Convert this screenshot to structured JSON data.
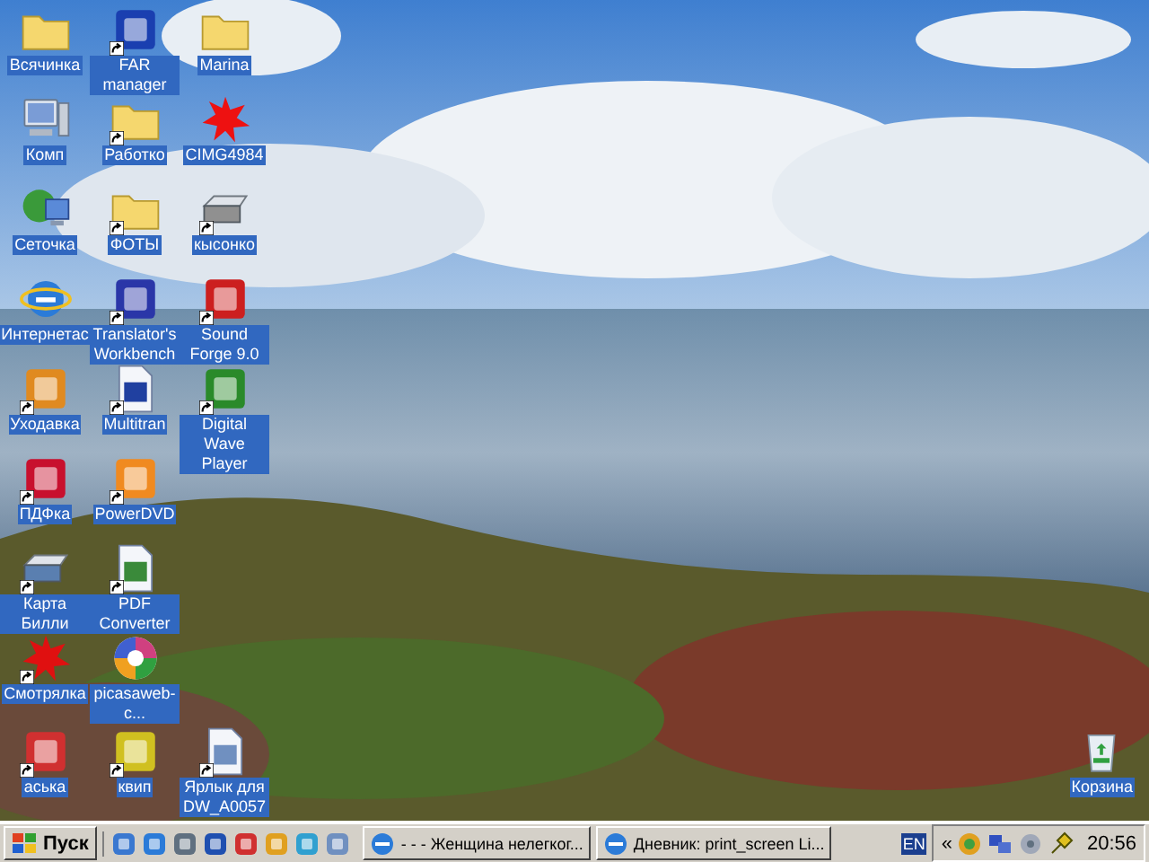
{
  "desktop": {
    "icon_columns": [
      [
        {
          "label": "Всячинка",
          "shortcut": false
        },
        {
          "label": "Комп",
          "shortcut": false
        },
        {
          "label": "Сеточка",
          "shortcut": false
        },
        {
          "label": "Интернетас",
          "shortcut": false
        },
        {
          "label": "Уходавка",
          "shortcut": true
        },
        {
          "label": "ПДФка",
          "shortcut": true
        },
        {
          "label": "Карта Билли",
          "shortcut": true
        },
        {
          "label": "Смотрялка",
          "shortcut": true
        },
        {
          "label": "аська",
          "shortcut": true
        }
      ],
      [
        {
          "label": "FAR manager",
          "shortcut": true
        },
        {
          "label": "Работко",
          "shortcut": true
        },
        {
          "label": "ФОТЫ",
          "shortcut": true
        },
        {
          "label": "Translator's Workbench",
          "shortcut": true
        },
        {
          "label": "Multitran",
          "shortcut": true
        },
        {
          "label": "PowerDVD",
          "shortcut": true
        },
        {
          "label": "PDF Converter",
          "shortcut": true
        },
        {
          "label": "picasaweb-c...",
          "shortcut": false
        },
        {
          "label": "квип",
          "shortcut": true
        }
      ],
      [
        {
          "label": "Marina",
          "shortcut": false
        },
        {
          "label": "CIMG4984",
          "shortcut": false
        },
        {
          "label": "кысонко",
          "shortcut": true
        },
        {
          "label": "Sound Forge 9.0",
          "shortcut": true
        },
        {
          "label": "Digital Wave Player",
          "shortcut": true
        },
        {
          "label": "Ярлык для DW_A0057",
          "shortcut": true
        }
      ]
    ],
    "recycle_bin": {
      "label": "Корзина"
    }
  },
  "taskbar": {
    "start_button": "Пуск",
    "tasks": [
      {
        "label": "- - - Женщина нелегког..."
      },
      {
        "label": "Дневник: print_screen Li..."
      }
    ],
    "tray": {
      "language": "EN",
      "chevron": "«",
      "clock": "20:56"
    }
  }
}
